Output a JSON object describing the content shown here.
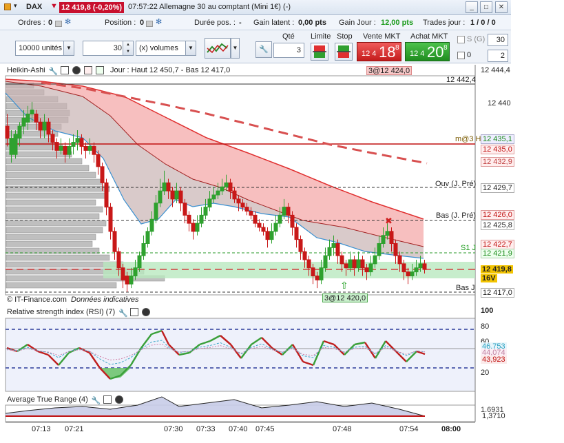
{
  "titlebar": {
    "symbol": "DAX",
    "price_change": "12 419,8 (-0,20%)",
    "description": "07:57:22 Allemagne 30 au comptant (Mini 1€) (-)"
  },
  "info": {
    "orders_label": "Ordres :",
    "orders_value": "0",
    "position_label": "Position :",
    "position_value": "0",
    "duree_label": "Durée pos. :",
    "duree_value": "-",
    "gain_latent_label": "Gain latent :",
    "gain_latent_value": "0,00 pts",
    "gain_jour_label": "Gain Jour :",
    "gain_jour_value": "12,00 pts",
    "trades_label": "Trades jour :",
    "trades_value": "1 / 0 / 0"
  },
  "order": {
    "units_select": "10000 unités",
    "qty_value": "30",
    "volume_select": "(x) volumes",
    "qte_label": "Qté",
    "qte_value": "3",
    "limite_label": "Limite",
    "stop_label": "Stop",
    "vente_label": "Vente MKT",
    "vente_small": "12 4",
    "vente_big": "18",
    "vente_sup": "8",
    "achat_label": "Achat MKT",
    "achat_small": "12 4",
    "achat_big": "20",
    "achat_sup": "8",
    "sg_label": "S (G)",
    "sg_value": "30",
    "zero_label": "0",
    "zero_value": "2"
  },
  "price_pane": {
    "title": "Heikin-Ashi",
    "header_info": "Jour : Haut 12 450,7 - Bas 12 417,0",
    "top_tag": "3@12 424,0",
    "bottom_tag": "3@12 420,0",
    "credit": "© IT-Finance.com",
    "credit_note": "Données indicatives",
    "axis": [
      "12 444,4",
      "12 440",
      "12 435,1",
      "12 435,0",
      "12 432,9",
      "12 429,7",
      "12 426,0",
      "12 425,8",
      "12 422,7",
      "12 421,9",
      "12 419,8",
      "12 417,0"
    ],
    "in_labels": [
      "12 442,4",
      "m@3 H",
      "Ouv (J. Pré)",
      "Bas (J. Pré)",
      "S1 J",
      "16V",
      "Bas J"
    ],
    "candles": [
      [
        8,
        0,
        12437.5,
        12436,
        12439,
        12435
      ],
      [
        14,
        1,
        12436,
        12434,
        12437,
        12433
      ],
      [
        20,
        1,
        12434,
        12436.5,
        12437,
        12433.5
      ],
      [
        26,
        1,
        12436,
        12437.5,
        12438,
        12435
      ],
      [
        32,
        1,
        12437.5,
        12438.5,
        12439.5,
        12436.5
      ],
      [
        38,
        1,
        12438,
        12439,
        12440,
        12437
      ],
      [
        44,
        1,
        12439,
        12439.5,
        12440.5,
        12438
      ],
      [
        50,
        0,
        12439,
        12438,
        12439.5,
        12437
      ],
      [
        56,
        0,
        12438,
        12437,
        12438.5,
        12436
      ],
      [
        62,
        1,
        12437,
        12438,
        12439,
        12436
      ],
      [
        68,
        0,
        12438,
        12436.5,
        12438.5,
        12435.5
      ],
      [
        74,
        0,
        12436.5,
        12435.5,
        12437,
        12434.5
      ],
      [
        80,
        0,
        12435.5,
        12434.5,
        12436,
        12433.5
      ],
      [
        86,
        1,
        12434.5,
        12435,
        12436,
        12434
      ],
      [
        92,
        0,
        12435,
        12434,
        12435.5,
        12433
      ],
      [
        98,
        1,
        12434,
        12435,
        12436,
        12433.5
      ],
      [
        104,
        1,
        12435,
        12435.5,
        12436.5,
        12434
      ],
      [
        110,
        1,
        12435.5,
        12436,
        12437,
        12434.5
      ],
      [
        116,
        0,
        12436,
        12435,
        12436.5,
        12434
      ],
      [
        122,
        0,
        12435,
        12434.5,
        12435.5,
        12433.5
      ],
      [
        128,
        1,
        12434.5,
        12435,
        12436,
        12434
      ],
      [
        134,
        0,
        12435,
        12434,
        12435.5,
        12433
      ],
      [
        140,
        0,
        12434,
        12432.5,
        12434.5,
        12431.5
      ],
      [
        146,
        0,
        12432.5,
        12430.5,
        12433,
        12429.5
      ],
      [
        152,
        0,
        12430.5,
        12427.5,
        12431,
        12426.5
      ],
      [
        158,
        0,
        12427.5,
        12424.5,
        12428,
        12423.5
      ],
      [
        164,
        0,
        12424.5,
        12422,
        12425,
        12421
      ],
      [
        170,
        0,
        12422,
        12420,
        12422.5,
        12419
      ],
      [
        176,
        0,
        12420,
        12418.5,
        12420.5,
        12417.5
      ],
      [
        182,
        0,
        12419,
        12418,
        12419.5,
        12417
      ],
      [
        188,
        1,
        12418,
        12419,
        12420,
        12417.5
      ],
      [
        194,
        1,
        12419,
        12420,
        12421,
        12418.5
      ],
      [
        200,
        1,
        12420,
        12421.5,
        12422,
        12419.5
      ],
      [
        206,
        1,
        12421.5,
        12423,
        12424,
        12421
      ],
      [
        212,
        1,
        12423,
        12424.5,
        12425,
        12422.5
      ],
      [
        218,
        1,
        12424.5,
        12426,
        12427,
        12424
      ],
      [
        224,
        1,
        12426,
        12428,
        12429,
        12425.5
      ],
      [
        230,
        1,
        12428,
        12429.5,
        12431,
        12427.5
      ],
      [
        236,
        1,
        12429.5,
        12430.5,
        12432,
        12429
      ],
      [
        242,
        0,
        12430.5,
        12429.5,
        12431,
        12428.5
      ],
      [
        248,
        0,
        12429.5,
        12428.5,
        12430,
        12427.5
      ],
      [
        254,
        1,
        12428.5,
        12429.5,
        12430.5,
        12428
      ],
      [
        260,
        0,
        12429.5,
        12428,
        12430,
        12427
      ],
      [
        266,
        0,
        12428,
        12426.5,
        12428.5,
        12425.5
      ],
      [
        272,
        0,
        12426.5,
        12425.5,
        12427,
        12424.5
      ],
      [
        278,
        0,
        12425.5,
        12424.5,
        12426,
        12423.5
      ],
      [
        284,
        1,
        12424.5,
        12425.5,
        12426.5,
        12424
      ],
      [
        290,
        1,
        12425.5,
        12426.5,
        12427.5,
        12425
      ],
      [
        296,
        1,
        12426.5,
        12427.5,
        12428.5,
        12426
      ],
      [
        302,
        1,
        12427.5,
        12428.5,
        12429.5,
        12427
      ],
      [
        308,
        1,
        12428.5,
        12429,
        12430,
        12428
      ],
      [
        314,
        1,
        12429,
        12429.5,
        12430.5,
        12428.5
      ],
      [
        320,
        1,
        12429.5,
        12430,
        12431,
        12429
      ],
      [
        326,
        1,
        12430,
        12430.5,
        12431.5,
        12429.5
      ],
      [
        332,
        0,
        12430.5,
        12429.5,
        12431,
        12428.5
      ],
      [
        338,
        0,
        12429.5,
        12428.5,
        12430,
        12428
      ],
      [
        344,
        0,
        12428.5,
        12428,
        12429,
        12427
      ],
      [
        350,
        0,
        12428,
        12427.5,
        12428.5,
        12427
      ],
      [
        356,
        0,
        12427.5,
        12427,
        12428,
        12426.5
      ],
      [
        362,
        0,
        12427,
        12426.5,
        12427.5,
        12426
      ],
      [
        368,
        0,
        12426.5,
        12425.5,
        12427,
        12425
      ],
      [
        374,
        0,
        12425.5,
        12425,
        12426,
        12424.5
      ],
      [
        380,
        0,
        12425,
        12424.5,
        12425.5,
        12424
      ],
      [
        386,
        0,
        12424.5,
        12423.5,
        12425,
        12422.5
      ],
      [
        392,
        1,
        12423.5,
        12424.5,
        12425.5,
        12423
      ],
      [
        398,
        1,
        12424.5,
        12425.5,
        12426.5,
        12424
      ],
      [
        404,
        1,
        12425.5,
        12426.5,
        12427.5,
        12425
      ],
      [
        410,
        1,
        12426.5,
        12427.5,
        12428.5,
        12426
      ],
      [
        416,
        0,
        12427.5,
        12426.5,
        12428,
        12425.5
      ],
      [
        422,
        0,
        12426.5,
        12425,
        12427,
        12424
      ],
      [
        428,
        0,
        12425,
        12423.5,
        12425.5,
        12422.5
      ],
      [
        434,
        0,
        12423.5,
        12422,
        12424,
        12421
      ],
      [
        440,
        0,
        12422,
        12421,
        12422.5,
        12420
      ],
      [
        446,
        0,
        12421,
        12420,
        12421.5,
        12419
      ],
      [
        452,
        0,
        12420,
        12419,
        12420.5,
        12418
      ],
      [
        458,
        0,
        12419,
        12418.5,
        12419.5,
        12417.5
      ],
      [
        464,
        1,
        12418.5,
        12420,
        12421,
        12418
      ],
      [
        470,
        1,
        12420,
        12421.5,
        12422.5,
        12419.5
      ],
      [
        476,
        1,
        12421.5,
        12422.5,
        12423.5,
        12421
      ],
      [
        482,
        1,
        12422.5,
        12423,
        12424,
        12421.5
      ],
      [
        488,
        0,
        12423,
        12421.5,
        12423.5,
        12420.5
      ],
      [
        494,
        0,
        12421.5,
        12420.5,
        12422,
        12419.5
      ],
      [
        500,
        0,
        12420.5,
        12420,
        12421,
        12419
      ],
      [
        506,
        1,
        12420,
        12421,
        12422,
        12419.5
      ],
      [
        512,
        0,
        12421,
        12420,
        12421.5,
        12419
      ],
      [
        518,
        1,
        12420,
        12421,
        12422,
        12419.5
      ],
      [
        524,
        0,
        12421,
        12420,
        12421.5,
        12419
      ],
      [
        530,
        0,
        12420,
        12419.5,
        12420.5,
        12418.5
      ],
      [
        536,
        1,
        12419.5,
        12420.5,
        12421.5,
        12419
      ],
      [
        542,
        1,
        12420.5,
        12421.5,
        12422.5,
        12420
      ],
      [
        548,
        1,
        12421.5,
        12423,
        12424,
        12421
      ],
      [
        554,
        1,
        12423,
        12424,
        12425,
        12422.5
      ],
      [
        560,
        1,
        12424,
        12424.5,
        12425.5,
        12423.5
      ],
      [
        566,
        0,
        12424.5,
        12423,
        12425,
        12422
      ],
      [
        572,
        0,
        12423,
        12421.5,
        12423.5,
        12420.5
      ],
      [
        578,
        0,
        12421.5,
        12420.5,
        12422,
        12419.5
      ],
      [
        584,
        0,
        12420.5,
        12419.5,
        12421,
        12418.5
      ],
      [
        590,
        0,
        12419.5,
        12419,
        12420,
        12418
      ],
      [
        596,
        1,
        12419,
        12419.5,
        12420.5,
        12418.5
      ],
      [
        602,
        1,
        12419.5,
        12420,
        12421,
        12419
      ],
      [
        608,
        1,
        12420,
        12420.5,
        12421.5,
        12419.5
      ],
      [
        614,
        0,
        12420.5,
        12419.8,
        12421,
        12419.3
      ]
    ]
  },
  "rsi_pane": {
    "title": "Relative strength index (RSI) (7)",
    "axis": [
      "100",
      "80",
      "60",
      "40",
      "20"
    ],
    "tags": [
      "46,753",
      "44,074",
      "43,923"
    ]
  },
  "atr_pane": {
    "title": "Average True Range (4)",
    "tags": [
      "1,6931",
      "1,3710"
    ]
  },
  "time_axis": [
    "07:13",
    "07:21",
    "07:30",
    "07:33",
    "07:40",
    "07:45",
    "07:48",
    "07:54",
    "08:00"
  ],
  "colors": {
    "bull": "#2fa12f",
    "bear": "#c81818",
    "band_red": "#f4a9a9",
    "band_grey": "#c9b3b3",
    "green_zone": "#b9e8bf",
    "rsi_bg": "#eef1fb"
  }
}
